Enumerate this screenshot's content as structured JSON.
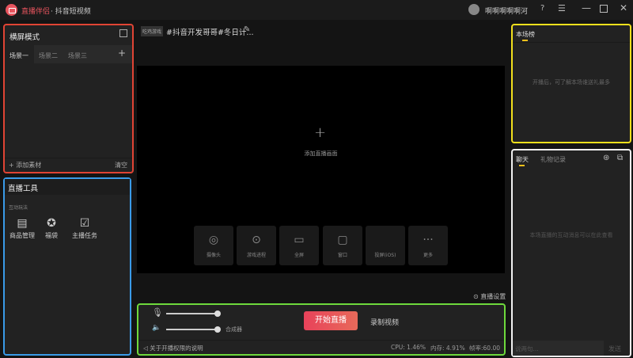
{
  "app": {
    "name": "直播伴侣",
    "subtitle": "· 抖音短视频",
    "username": "啊啊啊啊啊河",
    "accent": "#e8545e"
  },
  "scenes": {
    "title": "横屏模式",
    "tabs": [
      "场景一",
      "场景二",
      "场景三"
    ],
    "add_material": "添加素材",
    "clear": "清空"
  },
  "tools": {
    "title": "直播工具",
    "section": "互动玩法",
    "items": [
      {
        "label": "商品管理",
        "icon": "store-icon"
      },
      {
        "label": "福袋",
        "icon": "star-icon"
      },
      {
        "label": "主播任务",
        "icon": "task-icon"
      }
    ]
  },
  "stream": {
    "category": "吃鸡游戏",
    "title": "#抖音开发哥哥#冬日计...",
    "add_screen": "添加直播画面",
    "sources": [
      {
        "label": "摄像头",
        "icon": "camera-icon"
      },
      {
        "label": "游戏进程",
        "icon": "gamepad-icon"
      },
      {
        "label": "全屏",
        "icon": "monitor-icon"
      },
      {
        "label": "窗口",
        "icon": "window-icon"
      },
      {
        "label": "投屏(iOS)",
        "icon": "apple-icon"
      },
      {
        "label": "更多",
        "icon": "more-icon"
      }
    ],
    "settings": "直播设置"
  },
  "controls": {
    "mixer": "合成器",
    "start": "开始直播",
    "record": "录制视频",
    "notice": "关于开播权限的说明",
    "cpu": "CPU: 1.46%",
    "memory": "内存: 4.91%",
    "fps": "帧率:60.00",
    "mic_level": 1.0,
    "speaker_level": 1.0
  },
  "ranking": {
    "title": "本场榜",
    "empty": "开播后，可了解本场谁送礼最多"
  },
  "chat": {
    "tabs": [
      "聊天",
      "礼物记录"
    ],
    "empty": "本场直播的互动消息可以在此查看",
    "placeholder": "说两句...",
    "send": "发送"
  }
}
